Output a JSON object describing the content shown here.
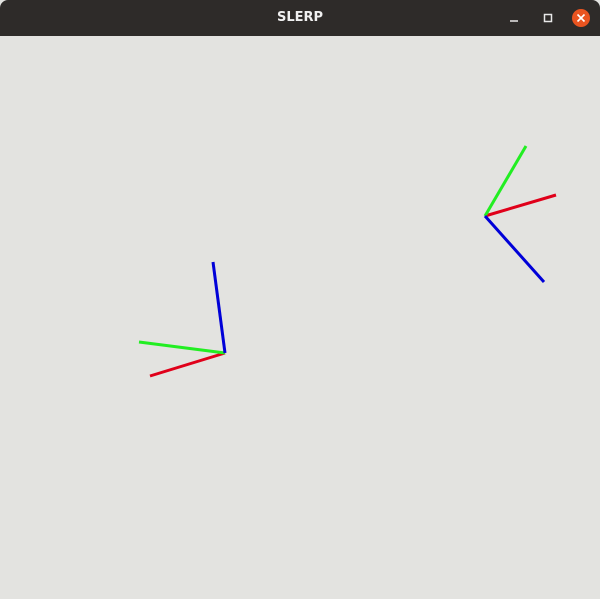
{
  "window": {
    "title": "SLERP"
  },
  "titlebar_buttons": {
    "minimize": "minimize-icon",
    "maximize": "maximize-icon",
    "close": "close-icon"
  },
  "colors": {
    "titlebar": "#2e2b29",
    "background": "#e3e3e0",
    "close_button": "#e95420",
    "x_axis": "#e0001a",
    "y_axis": "#22ee22",
    "z_axis": "#0000d8"
  }
}
